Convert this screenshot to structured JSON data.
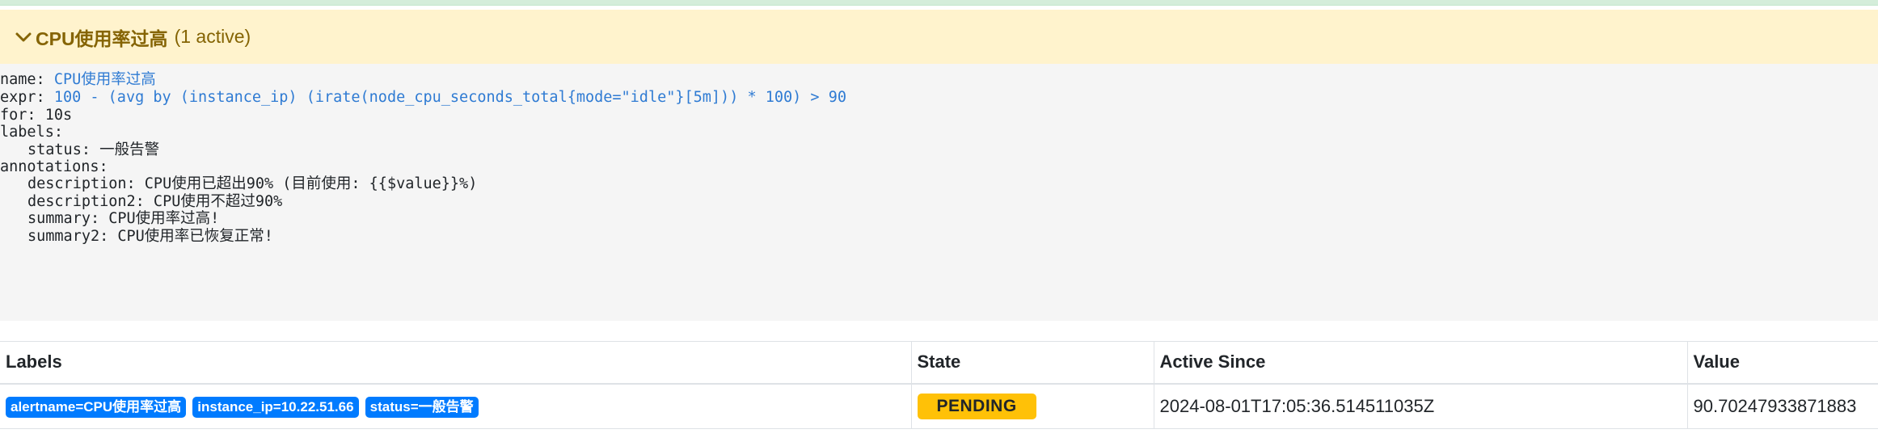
{
  "group": {
    "title": "CPU使用率过高",
    "count": "(1 active)"
  },
  "rule": {
    "name_key": "name:",
    "name_value": "CPU使用率过高",
    "expr_key": "expr:",
    "expr_value": "100 - (avg by (instance_ip) (irate(node_cpu_seconds_total{mode=\"idle\"}[5m])) * 100) > 90",
    "for_line": "for: 10s",
    "labels_key": "labels:",
    "labels": [
      "status: 一般告警"
    ],
    "annotations_key": "annotations:",
    "annotations": [
      "description: CPU使用已超出90% (目前使用: {{$value}}%)",
      "description2: CPU使用不超过90%",
      "summary: CPU使用率过高!",
      "summary2: CPU使用率已恢复正常!"
    ]
  },
  "table": {
    "headers": {
      "labels": "Labels",
      "state": "State",
      "active_since": "Active Since",
      "value": "Value"
    },
    "rows": [
      {
        "labels": [
          "alertname=CPU使用率过高",
          "instance_ip=10.22.51.66",
          "status=一般告警"
        ],
        "state": "PENDING",
        "active_since": "2024-08-01T17:05:36.514511035Z",
        "value": "90.70247933871883"
      }
    ]
  },
  "colors": {
    "header_bg": "#fff3cd",
    "header_text": "#856404",
    "label_badge": "#007bff",
    "pending_badge": "#ffc107",
    "expr_blue": "#2f7bd3"
  },
  "icons": {
    "collapse": "chevron-down-icon"
  }
}
